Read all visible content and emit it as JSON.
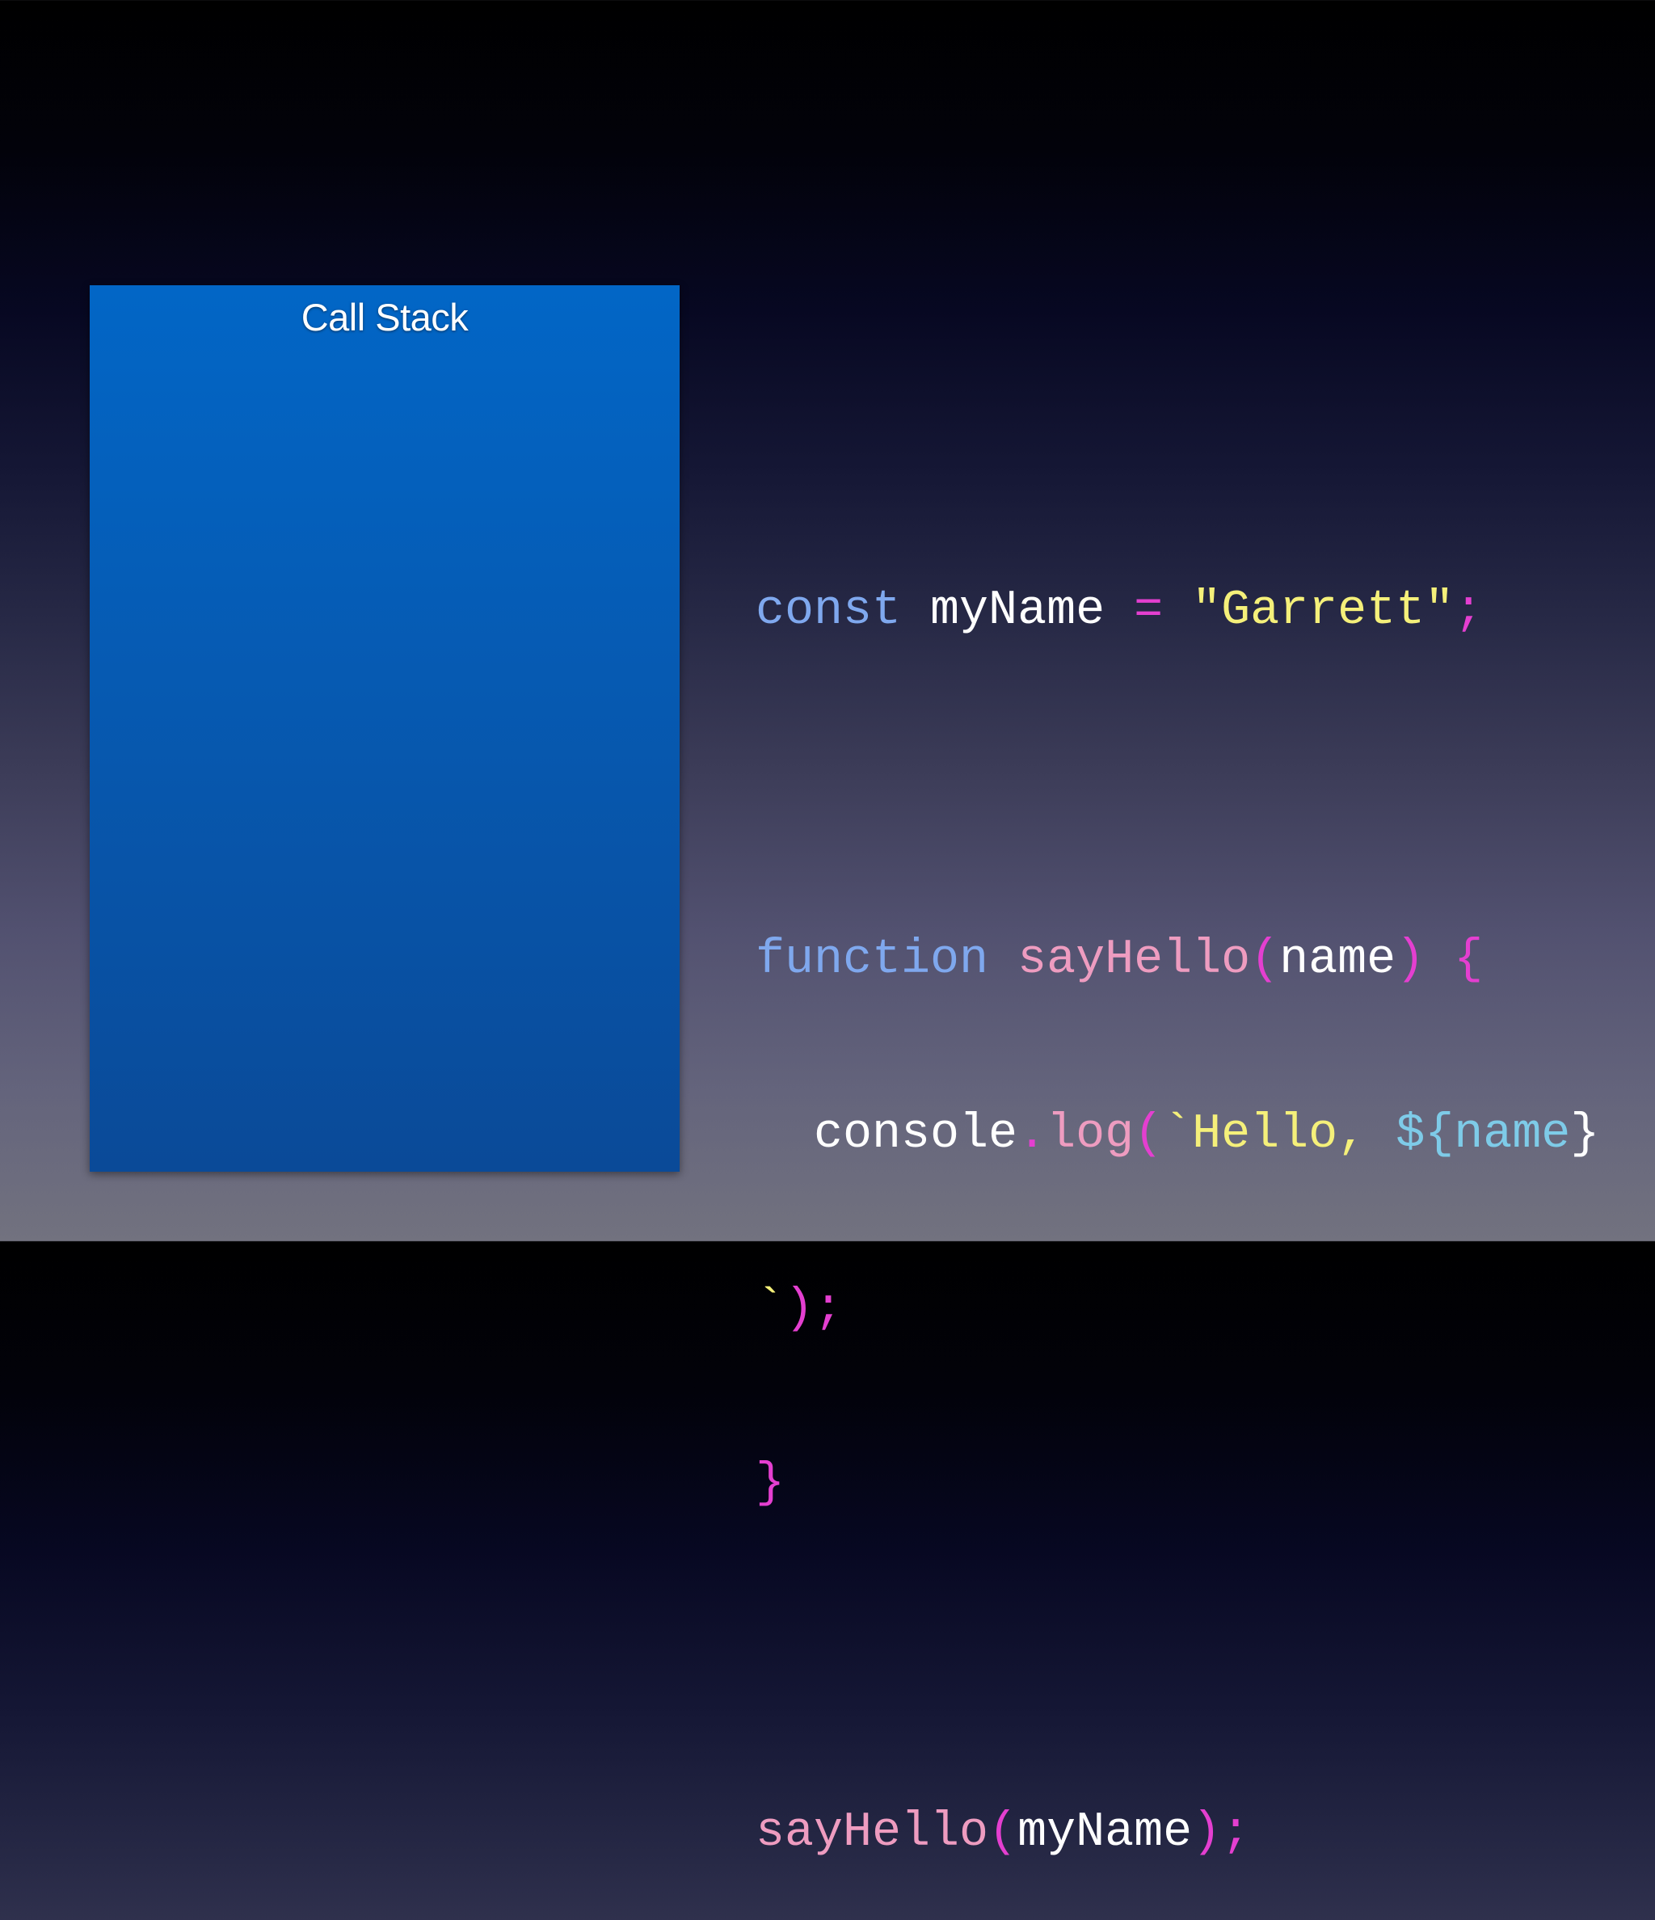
{
  "callstack": {
    "title": "Call Stack"
  },
  "code": {
    "line1": {
      "kw": "const",
      "var": "myName",
      "eq": "=",
      "str": "\"Garrett\"",
      "semi": ";"
    },
    "line2": {
      "kw": "function",
      "fn": "sayHello",
      "open": "(",
      "param": "name",
      "close": ")",
      "brace": "{"
    },
    "line3": {
      "obj": "console",
      "dot": ".",
      "method": "log",
      "open": "(",
      "tick": "`",
      "text": "Hello, ",
      "dollar": "${",
      "name": "name",
      "end": "}"
    },
    "line4": {
      "tick": "`",
      "close": ")",
      "semi": ";"
    },
    "line5": {
      "brace": "}"
    },
    "line6": {
      "fn": "sayHello",
      "open": "(",
      "arg": "myName",
      "close": ")",
      "semi": ";"
    }
  },
  "colors": {
    "keyword": "#7fa8ee",
    "function": "#ee9cc0",
    "operator": "#e43fd0",
    "string": "#f5f07a",
    "template": "#7ecbe8",
    "panel": "#0560bb"
  }
}
